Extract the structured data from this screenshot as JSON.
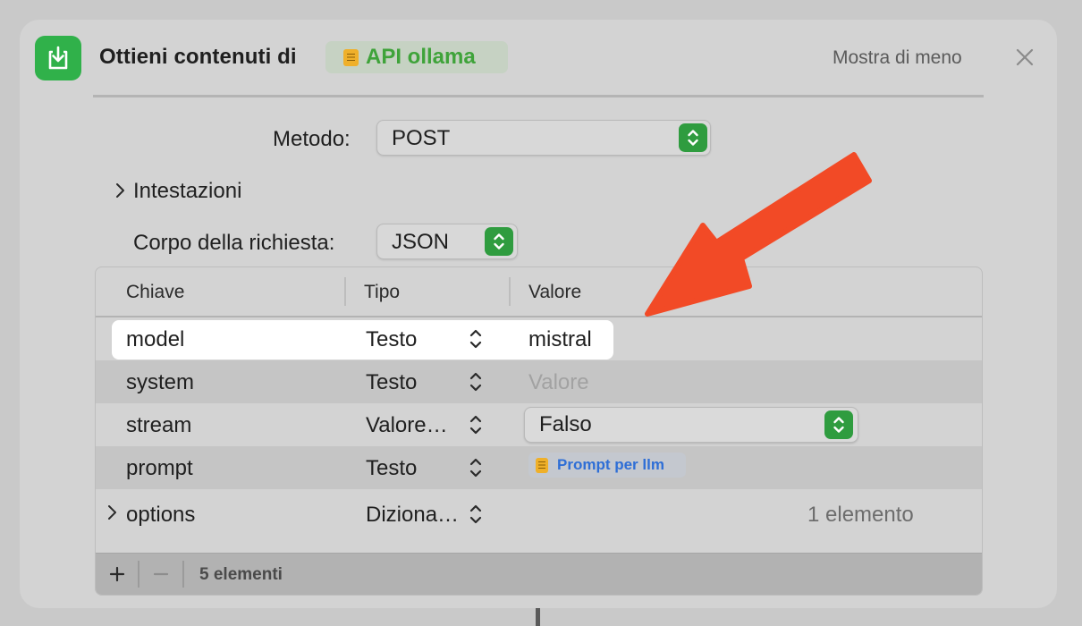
{
  "header": {
    "title": "Ottieni contenuti di",
    "variable": "API ollama",
    "show_less": "Mostra di meno",
    "icon": "download-box-icon",
    "accent_color": "#30b14a"
  },
  "method": {
    "label": "Metodo:",
    "value": "POST"
  },
  "headers_section": {
    "label": "Intestazioni"
  },
  "body": {
    "label": "Corpo della richiesta:",
    "value": "JSON"
  },
  "table": {
    "columns": [
      "Chiave",
      "Tipo",
      "Valore"
    ],
    "rows": [
      {
        "key": "model",
        "type": "Testo",
        "value": "mistral"
      },
      {
        "key": "system",
        "type": "Testo",
        "placeholder": "Valore"
      },
      {
        "key": "stream",
        "type": "Valore…",
        "value": "Falso"
      },
      {
        "key": "prompt",
        "type": "Testo",
        "variable": "Prompt per llm"
      },
      {
        "key": "options",
        "type": "Diziona…",
        "value": "1 elemento"
      }
    ],
    "footer": {
      "count": "5 elementi",
      "add": "+",
      "remove": "−"
    }
  },
  "annotation": {
    "arrow_color": "#f24a26"
  }
}
